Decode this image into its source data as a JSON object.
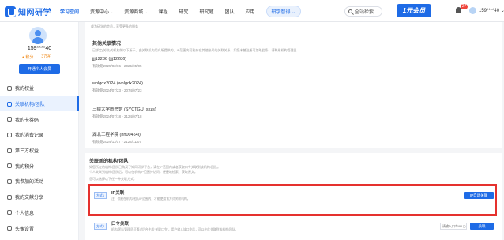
{
  "header": {
    "logo_text": "知网研学",
    "nav": [
      {
        "label": "学习空间",
        "active": true,
        "caret": false
      },
      {
        "label": "资源中心",
        "active": false,
        "caret": true
      },
      {
        "label": "资源商城",
        "active": false,
        "caret": true
      },
      {
        "label": "课程",
        "active": false,
        "caret": false
      },
      {
        "label": "研究",
        "active": false,
        "caret": false
      },
      {
        "label": "研究题",
        "active": false,
        "caret": false
      },
      {
        "label": "团队",
        "active": false,
        "caret": false
      },
      {
        "label": "应用",
        "active": false,
        "caret": false
      }
    ],
    "pill_label": "研学智得",
    "search_label": "全站检索",
    "promo_label": "1元会员",
    "bell_count": "27",
    "user_name": "159****40"
  },
  "sidebar": {
    "user_name": "159****40",
    "stat_points": "● 积分",
    "stat_balance": "375¥",
    "member_button": "开通个人会员",
    "items": [
      {
        "label": "我的权益",
        "active": false
      },
      {
        "label": "关联机构/团队",
        "active": true
      },
      {
        "label": "我的卡券码",
        "active": false
      },
      {
        "label": "我的消费记录",
        "active": false
      },
      {
        "label": "第三方权益",
        "active": false
      },
      {
        "label": "我的积分",
        "active": false
      },
      {
        "label": "我参加的活动",
        "active": false
      },
      {
        "label": "我的文献分享",
        "active": false
      },
      {
        "label": "个人信息",
        "active": false
      },
      {
        "label": "头像设置",
        "active": false
      }
    ]
  },
  "other_section": {
    "tip": "成为研学的会员，享受更多的服务",
    "title": "其他关联情况",
    "desc": "已绑定(关联)的机构如以下所示，由关联机构用户所提供的，IP范围内可能存在其他账号的关联关系，如您未曾注册可忽略此条，请联系机构管理员",
    "orgs": [
      {
        "name": "jjj12286 (jjj12286)",
        "date": "有效期2025/02/06 - 2025/05/05"
      },
      {
        "name": "whlgdx2024 (whlgdx2024)",
        "date": "有效期2024/07/23 - 2074/07/23"
      },
      {
        "name": "三峡大学图书馆 (SYCTGU_sxzs)",
        "date": "有效期2024/07/18 - 2124/07/18"
      },
      {
        "name": "湖北工程学院 (hh00454l)",
        "date": "有效期2024/11/07 - 2124/11/07"
      }
    ]
  },
  "link_section": {
    "title": "关联新的机构/团队",
    "desc_line1": "如您所在的机构/团队已购买了知网研学平台，请在IP范围内或者获取口令关联到该机构/团队。",
    "desc_line2": "个人关联到机构/团队后，可以在机构IP范围外访问，便捷地检索、获取原文。",
    "prompt": "您可以选择以下任一种关联方式：",
    "methods": [
      {
        "tag": "方式1",
        "name": "IP关联",
        "desc": "注：仅能在机构/团队IP范围内，才能使用该方式关联机构。",
        "button": "IP自动关联",
        "has_input": false,
        "input_placeholder": ""
      },
      {
        "tag": "方式2",
        "name": "口令关联",
        "desc": "机构/团队管理员可通过后台生成“关联口令”，用户输入该口令后，可以在此关联到该机构/团队。",
        "button": "关联",
        "has_input": true,
        "input_placeholder": "请输入口令/IP ▢"
      }
    ]
  }
}
